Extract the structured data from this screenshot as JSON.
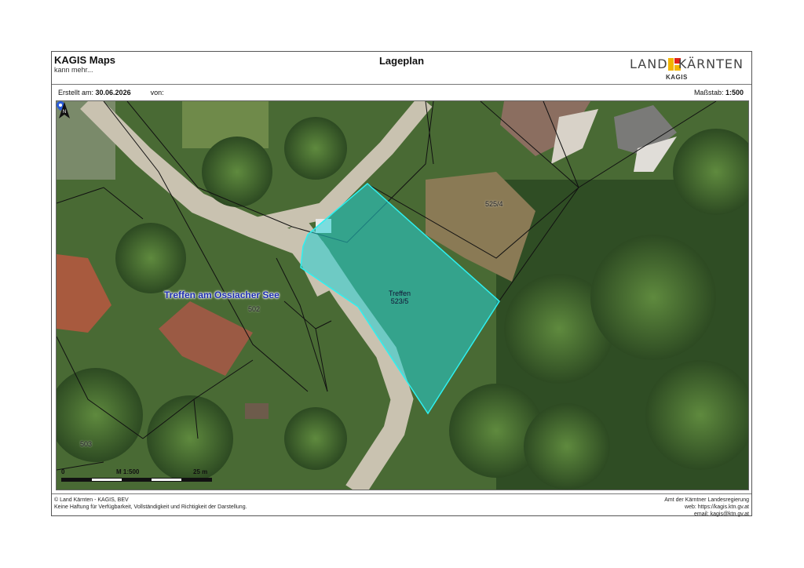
{
  "header": {
    "app_title": "KAGIS Maps",
    "app_subtitle": "kann mehr...",
    "plan_title": "Lageplan",
    "logo_left": "LAND",
    "logo_right": "KÄRNTEN",
    "logo_sub": "KAGIS"
  },
  "meta": {
    "created_label": "Erstellt am:",
    "created_date": "30.06.2026",
    "by_label": "von:",
    "by_value": "",
    "scale_label": "Maßstab:",
    "scale_value": "1:500"
  },
  "map": {
    "place_label": "Treffen am Ossiacher See",
    "parcels": [
      "525/4",
      "502",
      "503"
    ],
    "target": {
      "name": "Treffen",
      "parcel": "523/5"
    },
    "highlight_color": "#33d6d6",
    "scalebar": {
      "start": "0",
      "middle": "M 1:500",
      "end": "25 m"
    },
    "north_icon": "north-arrow-icon"
  },
  "footer": {
    "left_line1": "© Land Kärnten - KAGIS, BEV",
    "left_line2": "Keine Haftung für Verfügbarkeit, Vollständigkeit und Richtigkeit der Darstellung.",
    "right_line1": "Amt der Kärntner Landesregierung",
    "right_line2": "web: https://kagis.ktn.gv.at",
    "right_line3": "email: kagis@ktn.gv.at"
  }
}
